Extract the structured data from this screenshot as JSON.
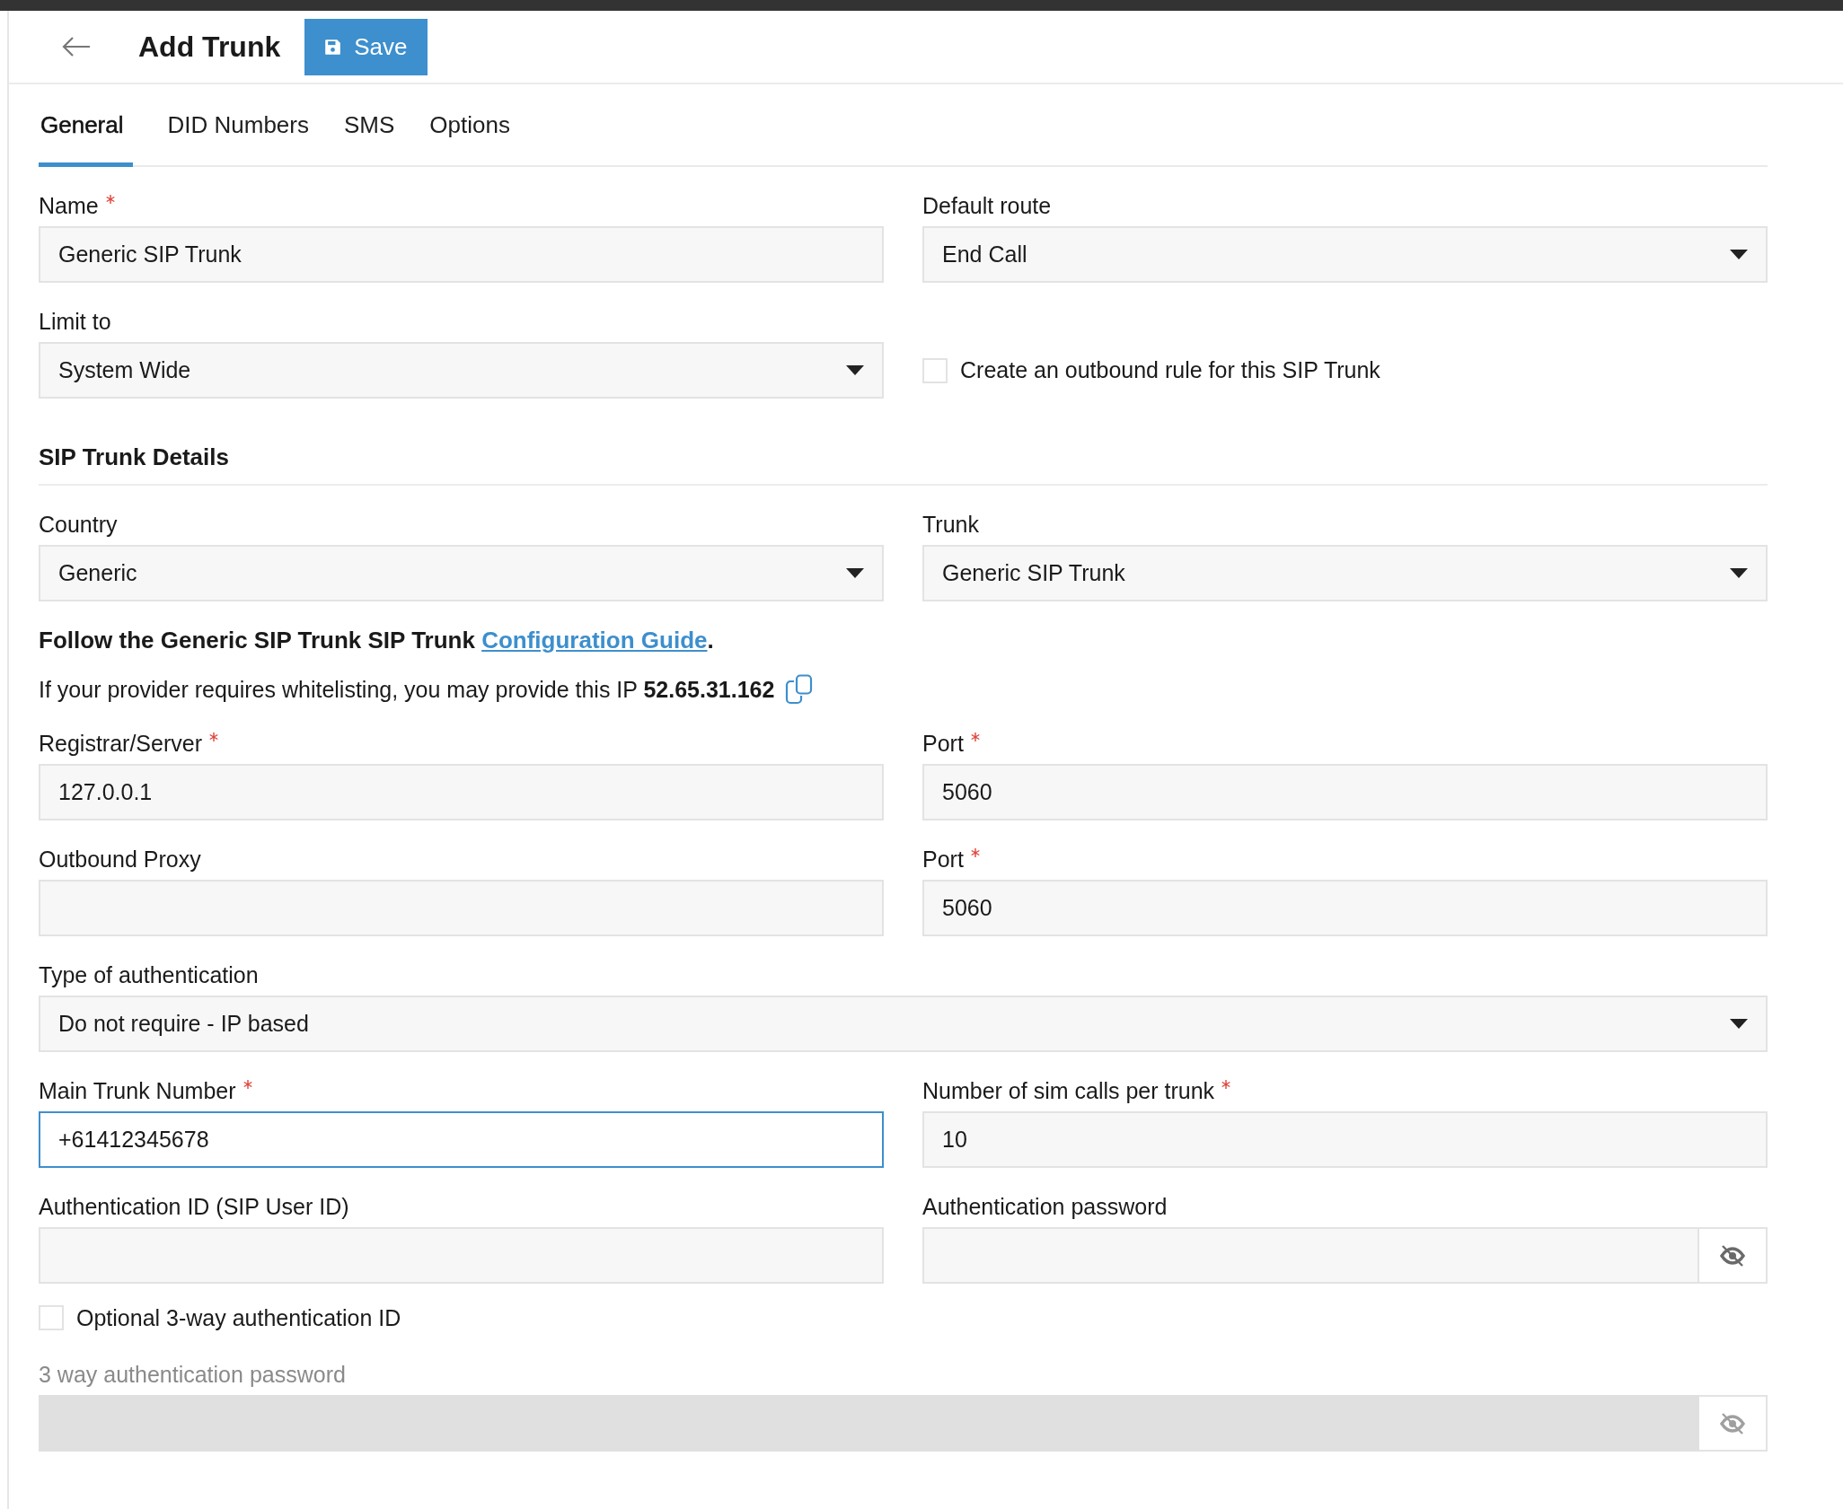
{
  "header": {
    "title": "Add Trunk",
    "save_button": "Save"
  },
  "tabs": [
    {
      "label": "General",
      "selected": true
    },
    {
      "label": "DID Numbers",
      "selected": false
    },
    {
      "label": "SMS",
      "selected": false
    },
    {
      "label": "Options",
      "selected": false
    }
  ],
  "rows": [
    {
      "kind": "fields",
      "fields": [
        {
          "kind": "text",
          "label": "Name",
          "required": true,
          "value": "Generic SIP Trunk",
          "focused": false
        },
        {
          "kind": "select",
          "label": "Default route",
          "required": false,
          "value": "End Call"
        }
      ]
    },
    {
      "kind": "fields",
      "fields": [
        {
          "kind": "select",
          "label": "Limit to",
          "required": false,
          "value": "System Wide"
        },
        {
          "kind": "checkbox",
          "label": "Create an outbound rule for this SIP Trunk",
          "checked": false
        }
      ]
    },
    {
      "kind": "heading",
      "text": "SIP Trunk Details"
    },
    {
      "kind": "fields",
      "fields": [
        {
          "kind": "select",
          "label": "Country",
          "required": false,
          "value": "Generic"
        },
        {
          "kind": "select",
          "label": "Trunk",
          "required": false,
          "value": "Generic SIP Trunk"
        }
      ]
    },
    {
      "kind": "guide",
      "text": "Follow the Generic SIP Trunk SIP Trunk",
      "link": "Configuration Guide",
      "after": "."
    },
    {
      "kind": "ip",
      "text": "If your provider requires whitelisting, you may provide this IP",
      "ip": "52.65.31.162"
    },
    {
      "kind": "fields",
      "fields": [
        {
          "kind": "text",
          "label": "Registrar/Server",
          "required": true,
          "value": "127.0.0.1",
          "focused": false
        },
        {
          "kind": "text",
          "label": "Port",
          "required": true,
          "value": "5060",
          "focused": false
        }
      ]
    },
    {
      "kind": "fields",
      "fields": [
        {
          "kind": "text",
          "label": "Outbound Proxy",
          "required": false,
          "focused": false
        },
        {
          "kind": "text",
          "label": "Port",
          "required": true,
          "value": "5060",
          "focused": false
        }
      ]
    },
    {
      "kind": "fields",
      "fields": [
        {
          "kind": "select",
          "label": "Type of authentication",
          "required": false,
          "value": "Do not require - IP based"
        }
      ]
    },
    {
      "kind": "fields",
      "fields": [
        {
          "kind": "text",
          "label": "Main Trunk Number",
          "required": true,
          "value": "+61412345678",
          "focused": true
        },
        {
          "kind": "text",
          "label": "Number of sim calls per trunk",
          "required": true,
          "value": "10",
          "focused": false
        }
      ]
    },
    {
      "kind": "fields",
      "fields": [
        {
          "kind": "text",
          "label": "Authentication ID (SIP User ID)",
          "required": false,
          "focused": false
        },
        {
          "kind": "password",
          "label": "Authentication password",
          "required": false,
          "disabled": false
        }
      ]
    },
    {
      "kind": "fields",
      "fields": [
        {
          "kind": "checkbox",
          "label": "Optional 3-way authentication ID",
          "checked": false
        }
      ]
    },
    {
      "kind": "fields",
      "fields": [
        {
          "kind": "password",
          "label": "3 way authentication password",
          "required": false,
          "disabled": true
        }
      ]
    }
  ]
}
